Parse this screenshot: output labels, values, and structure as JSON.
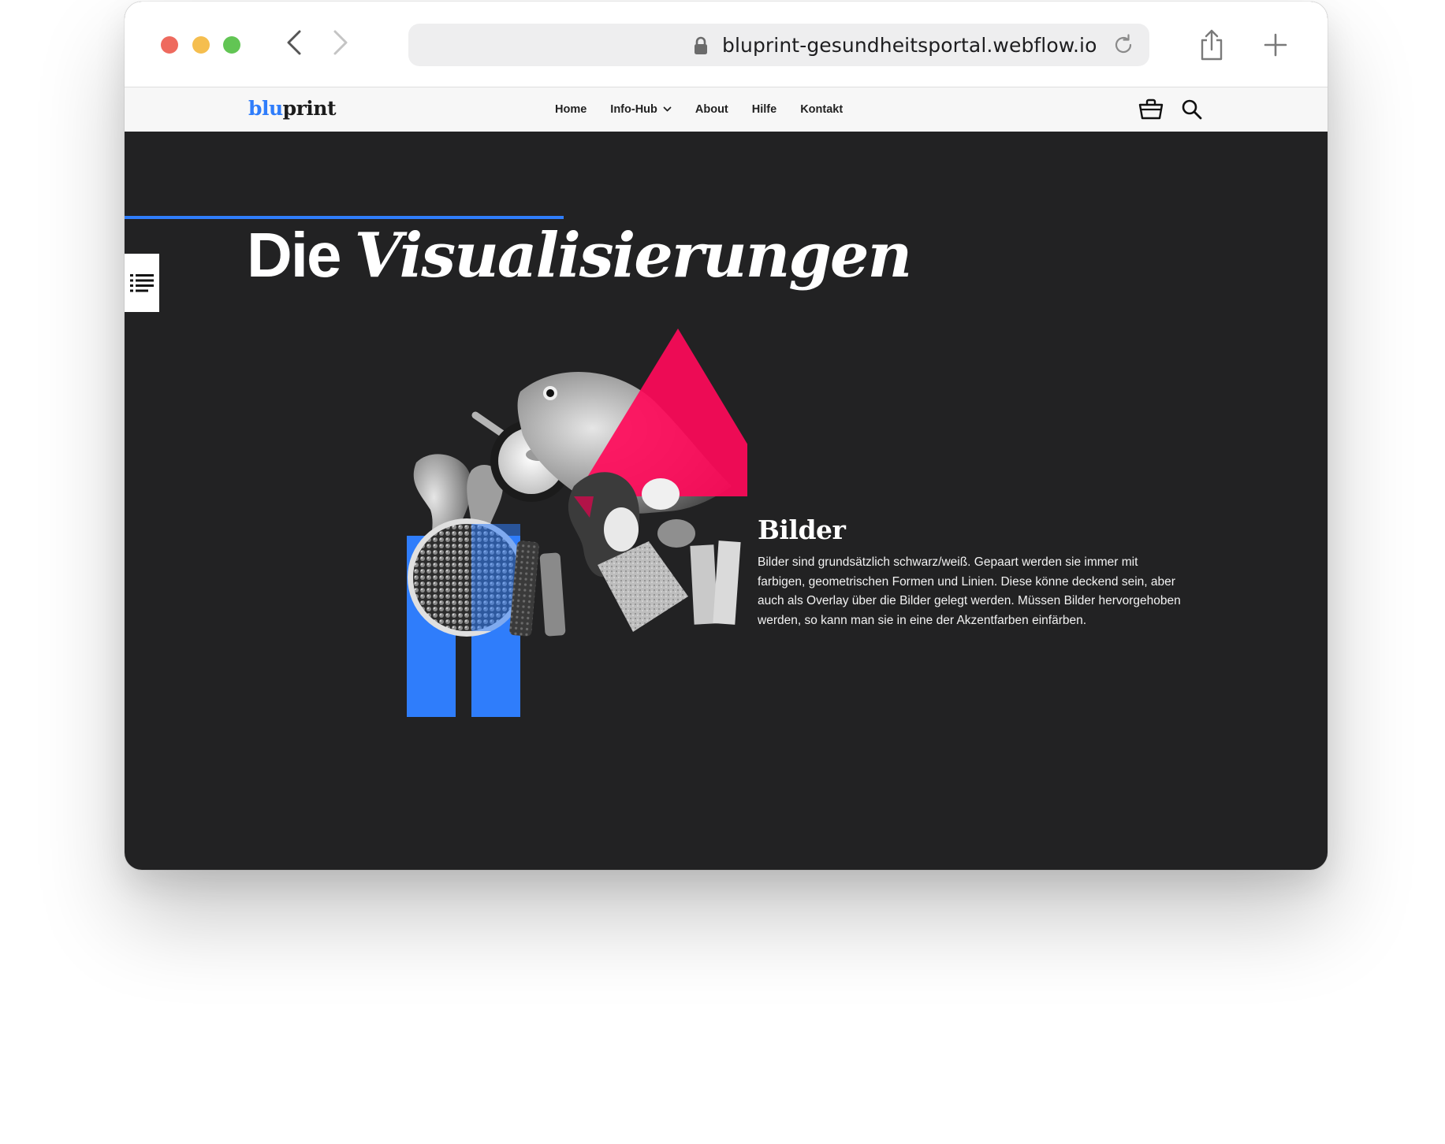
{
  "browser": {
    "url": "bluprint-gesundheitsportal.webflow.io",
    "icons": [
      "back-arrow",
      "forward-arrow",
      "lock",
      "reload",
      "share",
      "plus"
    ]
  },
  "site": {
    "logo": {
      "part1": "blu",
      "part2": "print"
    },
    "nav": {
      "home": "Home",
      "infohub": "Info-Hub",
      "about": "About",
      "hilfe": "Hilfe",
      "kontakt": "Kontakt"
    },
    "scroll_progress": 0.365,
    "colors": {
      "accent_blue": "#2f7dfb",
      "accent_pink": "#ff0a5a",
      "background_dark": "#222223"
    }
  },
  "main": {
    "heading_plain": "Die",
    "heading_italic": "Visualisierungen",
    "section_title": "Bilder",
    "section_text": "Bilder sind grundsätzlich schwarz/weiß. Gepaart werden sie immer mit farbigen, geometrischen Formen und Linien. Diese könne deckend sein, aber auch als Overlay über die Bilder gelegt werden. Müssen Bilder hervorgehoben werden, so kann man sie in eine der Akzentfarben einfärben."
  }
}
